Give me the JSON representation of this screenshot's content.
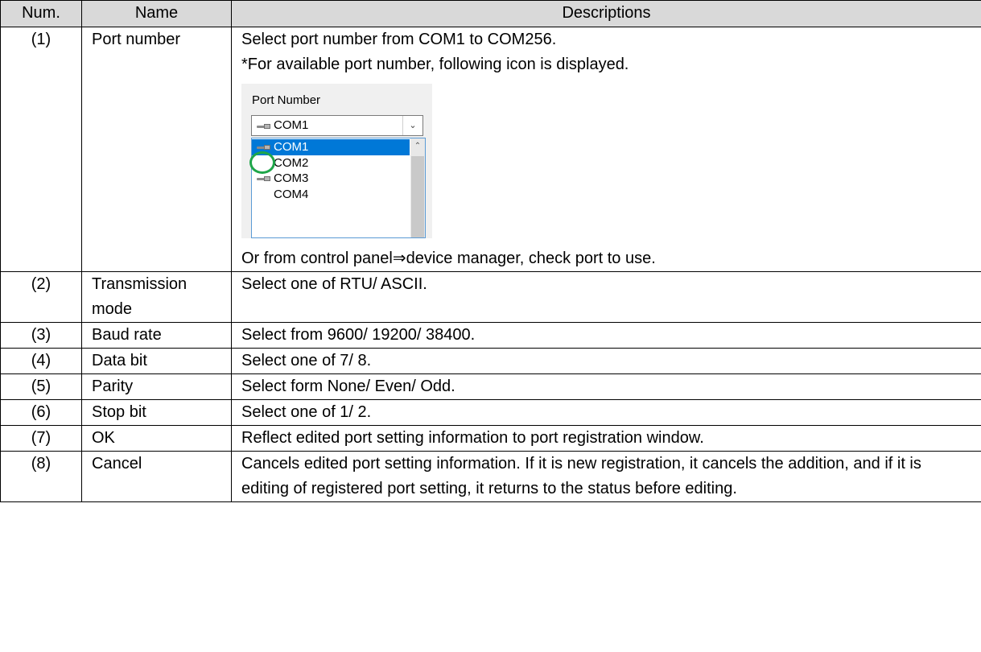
{
  "headers": {
    "num": "Num.",
    "name": "Name",
    "desc": "Descriptions"
  },
  "rows": [
    {
      "num": "(1)",
      "name": "Port number",
      "desc": [
        "Select port number from COM1 to COM256.",
        "*For available port number, following icon is displayed."
      ],
      "after": "Or from control panel⇒device manager, check port to use."
    },
    {
      "num": "(2)",
      "name": "Transmission mode",
      "desc": [
        "Select one of RTU/ ASCII."
      ]
    },
    {
      "num": "(3)",
      "name": "Baud rate",
      "desc": [
        "Select from 9600/ 19200/ 38400."
      ]
    },
    {
      "num": "(4)",
      "name": "Data bit",
      "desc": [
        "Select one of 7/ 8."
      ]
    },
    {
      "num": "(5)",
      "name": "Parity",
      "desc": [
        "Select form None/ Even/ Odd."
      ]
    },
    {
      "num": "(6)",
      "name": "Stop bit",
      "desc": [
        "Select one of 1/ 2."
      ]
    },
    {
      "num": "(7)",
      "name": "OK",
      "desc": [
        "Reflect edited port setting information to port registration window."
      ]
    },
    {
      "num": "(8)",
      "name": "Cancel",
      "desc": [
        "Cancels edited port setting information. If it is new registration, it cancels the addition, and if it is editing of registered port setting, it returns to the status before editing."
      ]
    }
  ],
  "screenshot": {
    "label": "Port Number",
    "combo_value": "COM1",
    "list": [
      {
        "text": "COM1",
        "icon": "serial-port-icon",
        "selected": true
      },
      {
        "text": "COM2",
        "icon": "",
        "selected": false
      },
      {
        "text": "COM3",
        "icon": "serial-port-icon",
        "selected": false
      },
      {
        "text": "COM4",
        "icon": "",
        "selected": false
      }
    ],
    "highlight_color": "#1fa64a",
    "selection_color": "#0078d7"
  }
}
